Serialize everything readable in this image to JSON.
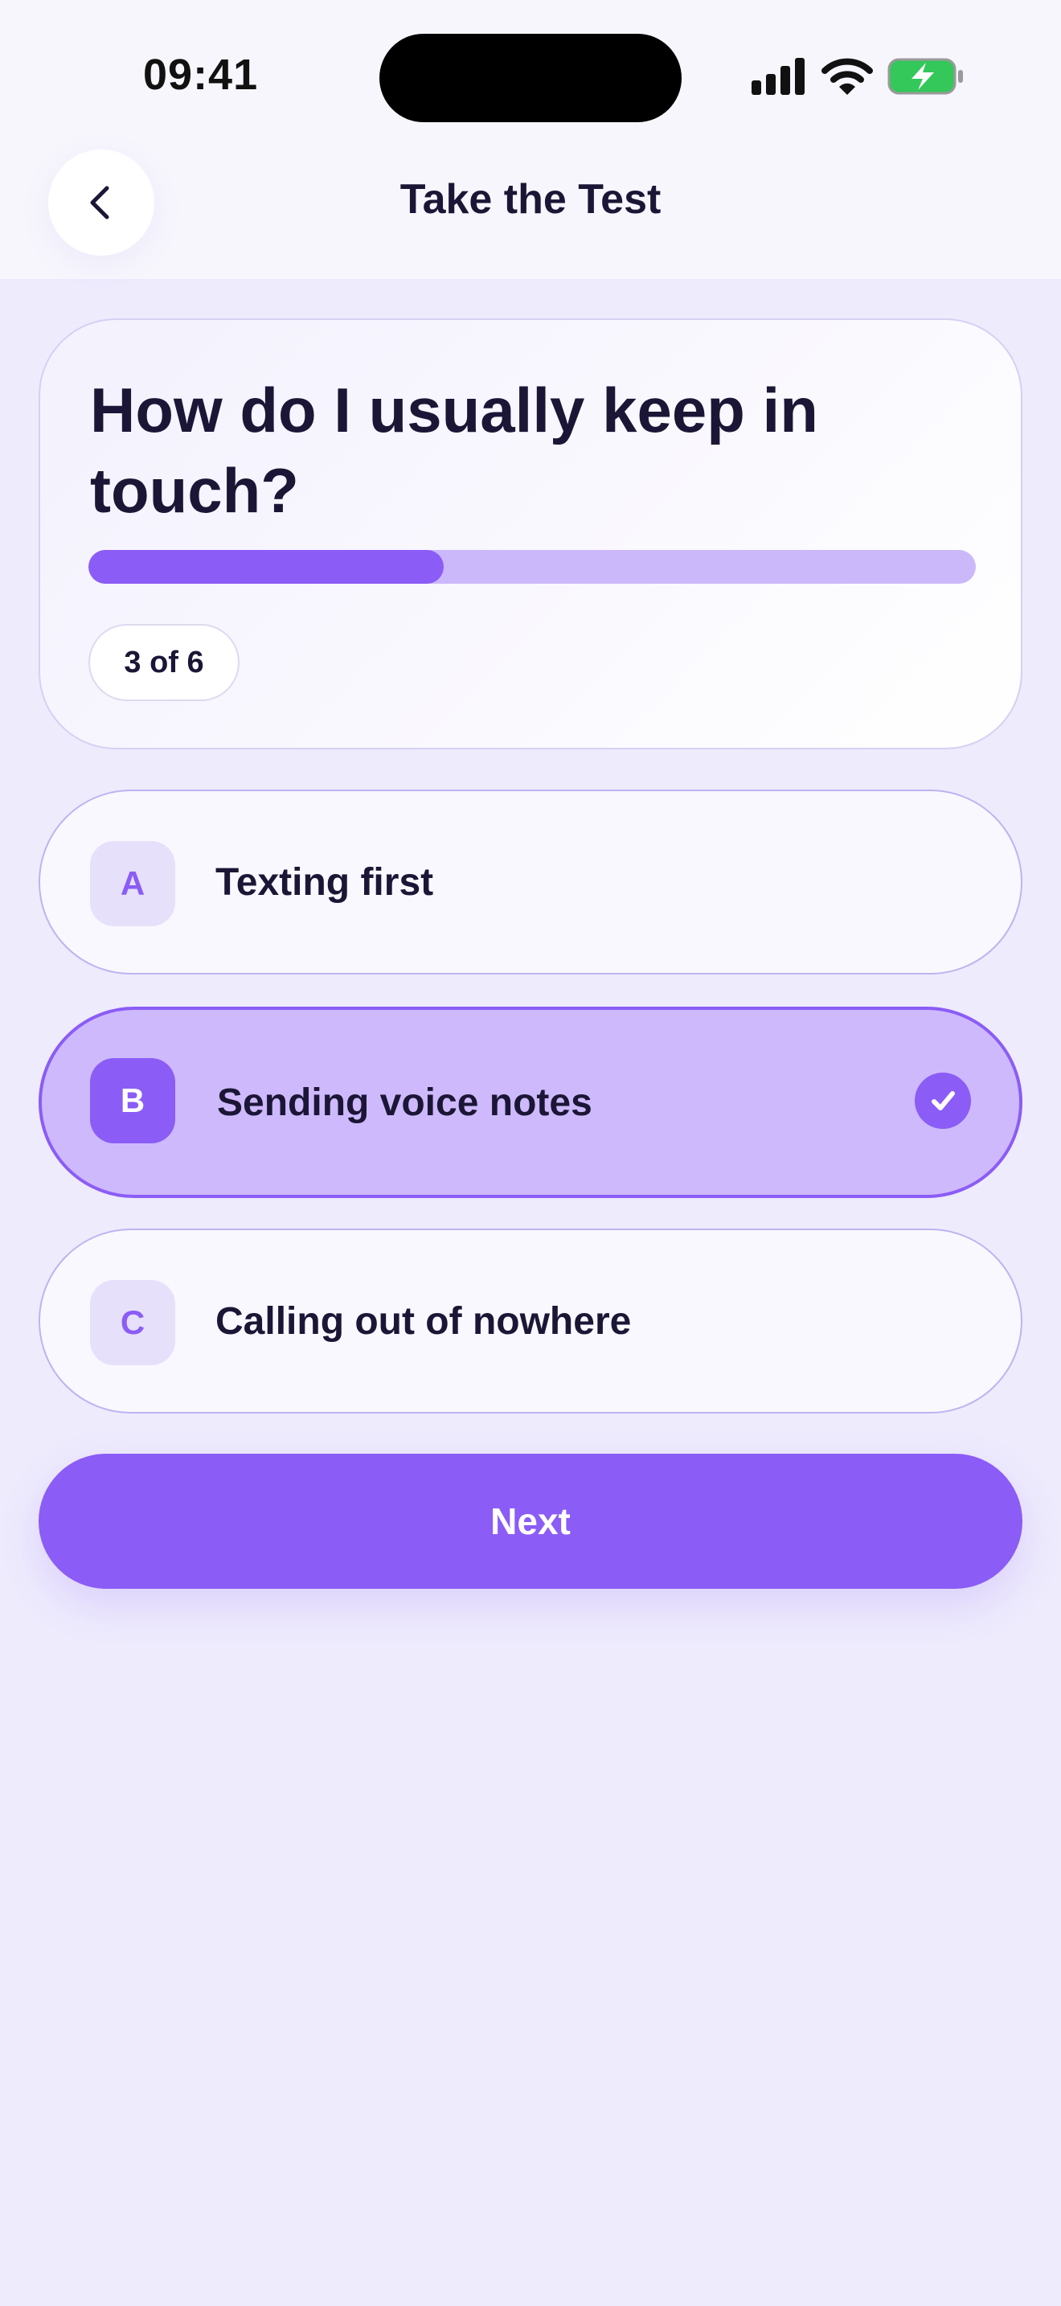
{
  "status_bar": {
    "time": "09:41"
  },
  "header": {
    "title": "Take the Test",
    "back_icon": "chevron-left-icon"
  },
  "question": {
    "text": "How do I usually keep in touch?",
    "current": 3,
    "total": 6,
    "counter_label": "3 of 6",
    "progress_fraction": 0.4
  },
  "options": [
    {
      "letter": "A",
      "label": "Texting first",
      "selected": false
    },
    {
      "letter": "B",
      "label": "Sending voice notes",
      "selected": true
    },
    {
      "letter": "C",
      "label": "Calling out of nowhere",
      "selected": false
    }
  ],
  "next_button": {
    "label": "Next"
  },
  "colors": {
    "accent": "#8b5cf6",
    "background": "#eeebfd",
    "text": "#1c1636",
    "selected_option": "#cdb9fc",
    "battery_green": "#34c759"
  }
}
